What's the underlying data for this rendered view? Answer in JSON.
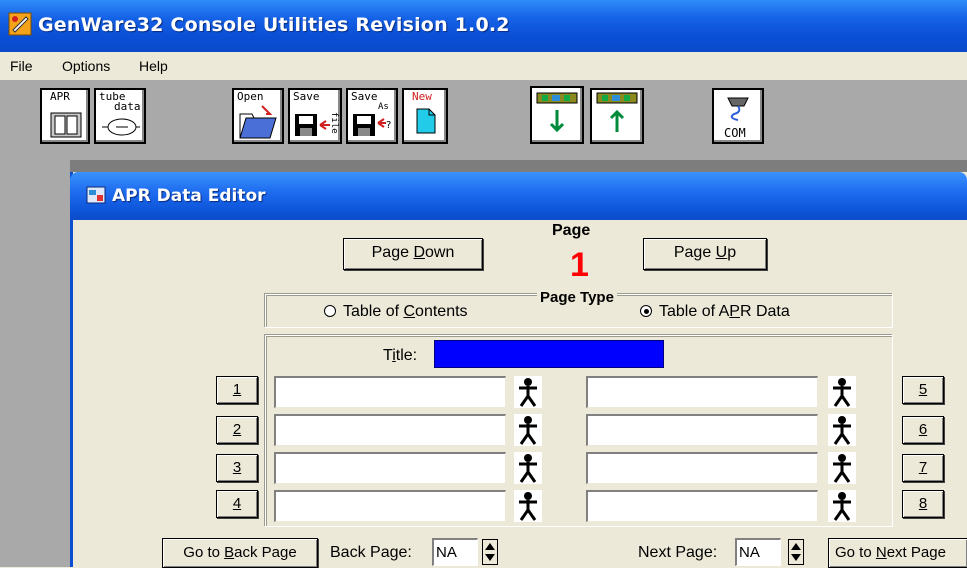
{
  "app": {
    "title": "GenWare32 Console Utilities Revision 1.0.2"
  },
  "menu": {
    "items": [
      "File",
      "Options",
      "Help"
    ]
  },
  "toolbar": {
    "apr_label": "APR",
    "tube_label": "tube",
    "tube_data_label": "data",
    "open_label": "Open",
    "save_file_label": "Save",
    "save_file_sub": "file",
    "save_as_label": "Save",
    "save_as_sub": "As",
    "new_label": "New",
    "com_label": "COM"
  },
  "editor": {
    "title": "APR Data Editor",
    "page_down_pre": "Page ",
    "page_down_key": "D",
    "page_down_post": "own",
    "page_up_pre": "Page ",
    "page_up_key": "U",
    "page_up_post": "p",
    "page_label": "Page",
    "page_number": "1",
    "page_type_label": "Page Type",
    "page_type_options": [
      {
        "pre": "Table of ",
        "key": "C",
        "post": "ontents",
        "selected": false
      },
      {
        "pre": "Table of A",
        "key": "P",
        "post": "R Data",
        "selected": true
      }
    ],
    "title_label_pre": "T",
    "title_label_key": "i",
    "title_label_post": "tle:",
    "title_value": "",
    "row_buttons_left": [
      "1",
      "2",
      "3",
      "4"
    ],
    "row_buttons_right": [
      "5",
      "6",
      "7",
      "8"
    ],
    "go_back_pre": "Go to ",
    "go_back_key": "B",
    "go_back_post": "ack Page",
    "back_page_label": "Back Page:",
    "back_page_value": "NA",
    "next_page_label": "Next Page:",
    "next_page_value": "NA",
    "go_next_pre": "Go to ",
    "go_next_key": "N",
    "go_next_post": "ext Page"
  },
  "colors": {
    "titlebar": "#0b4ac9",
    "page_number": "#ff0000",
    "title_field": "#0000ff",
    "toolbar_bg": "#a9a9a9"
  }
}
